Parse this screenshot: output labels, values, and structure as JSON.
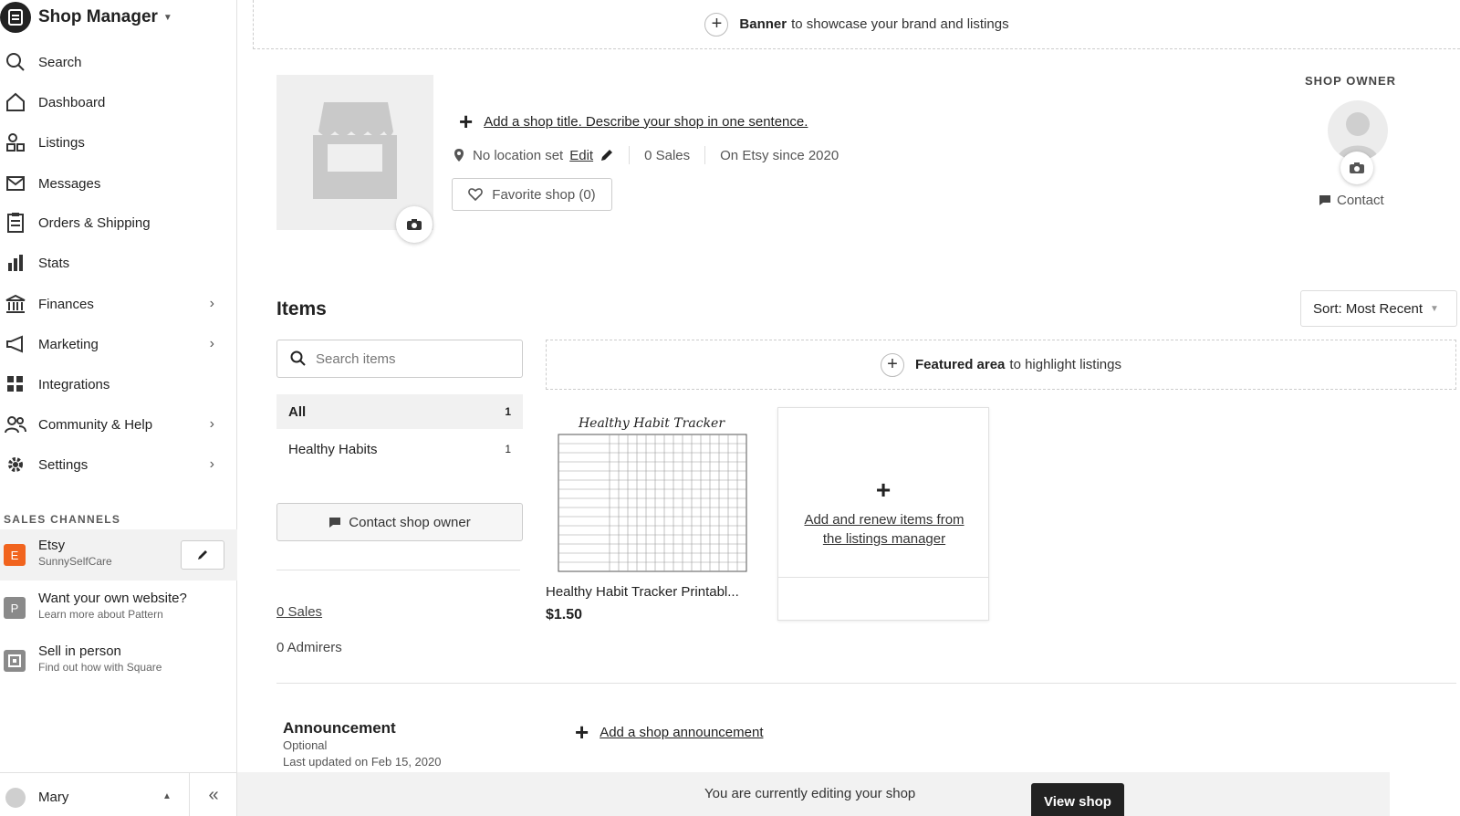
{
  "sidebar": {
    "brand": "Shop Manager",
    "nav": [
      {
        "label": "Search",
        "icon": "search-icon"
      },
      {
        "label": "Dashboard",
        "icon": "home-icon"
      },
      {
        "label": "Listings",
        "icon": "listings-icon"
      },
      {
        "label": "Messages",
        "icon": "envelope-icon"
      },
      {
        "label": "Orders & Shipping",
        "icon": "clipboard-icon"
      },
      {
        "label": "Stats",
        "icon": "bar-chart-icon"
      },
      {
        "label": "Finances",
        "icon": "bank-icon"
      },
      {
        "label": "Marketing",
        "icon": "megaphone-icon"
      },
      {
        "label": "Integrations",
        "icon": "grid-icon"
      },
      {
        "label": "Community & Help",
        "icon": "people-icon"
      },
      {
        "label": "Settings",
        "icon": "gear-icon"
      }
    ],
    "sales_channels_label": "SALES CHANNELS",
    "channels": [
      {
        "badge": "E",
        "name": "Etsy",
        "sub": "SunnySelfCare",
        "color": "#f1641e"
      },
      {
        "badge": "P",
        "name": "Want your own website?",
        "sub": "Learn more about Pattern",
        "color": "#8a8a8a"
      },
      {
        "badge": "",
        "name": "Sell in person",
        "sub": "Find out how with Square",
        "color": "#8a8a8a"
      }
    ],
    "user": "Mary"
  },
  "banner": {
    "strong": "Banner",
    "rest": "to showcase your brand and listings"
  },
  "shop": {
    "title_link": "Add a shop title. Describe your shop in one sentence.",
    "location": "No location set",
    "edit_label": "Edit",
    "sales": "0 Sales",
    "since": "On Etsy since 2020",
    "favorite": "Favorite shop (0)",
    "owner_label": "SHOP OWNER",
    "owner_contact": "Contact"
  },
  "items": {
    "title": "Items",
    "sort": "Sort: Most Recent",
    "search_placeholder": "Search items",
    "categories": [
      {
        "label": "All",
        "count": "1"
      },
      {
        "label": "Healthy Habits",
        "count": "1"
      }
    ],
    "contact_owner": "Contact shop owner",
    "sales_link": "0 Sales",
    "admirers": "0 Admirers",
    "featured_strong": "Featured area",
    "featured_rest": "to highlight listings",
    "listing": {
      "thumb_title": "Healthy Habit Tracker",
      "title": "Healthy Habit Tracker Printabl...",
      "price": "$1.50"
    },
    "add_card_text": "Add and renew items from the listings manager"
  },
  "announcement": {
    "title": "Announcement",
    "optional": "Optional",
    "updated": "Last updated on Feb 15, 2020",
    "add_link": "Add a shop announcement"
  },
  "edit_bar": {
    "message": "You are currently editing your shop",
    "view_shop": "View shop"
  }
}
